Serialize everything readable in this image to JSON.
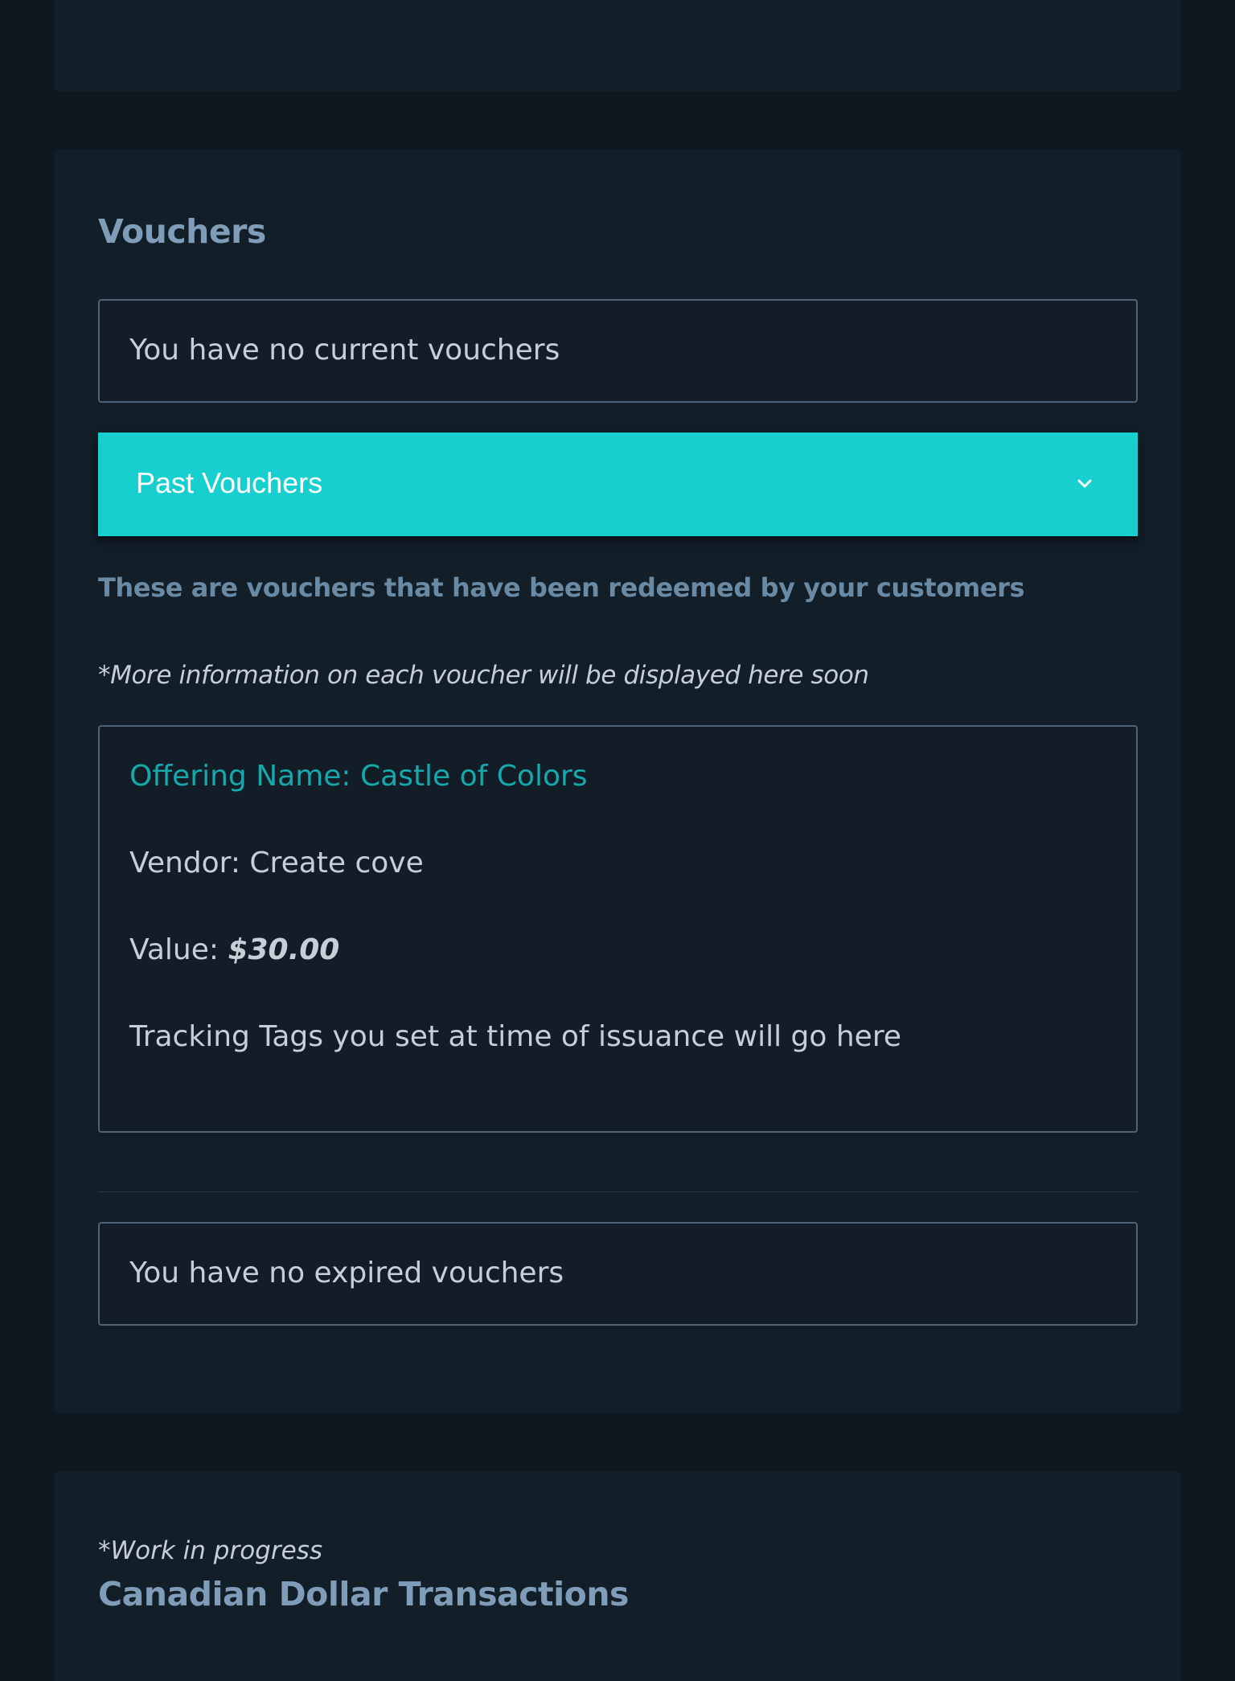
{
  "vouchers": {
    "title": "Vouchers",
    "current_empty": "You have no current vouchers",
    "past_toggle_label": "Past Vouchers",
    "past_description": "These are vouchers that have been redeemed by your customers",
    "past_note": "*More information on each voucher will be displayed here soon",
    "items": [
      {
        "offering_label": "Offering Name: ",
        "offering_name": "Castle of Colors",
        "vendor_label": "Vendor: ",
        "vendor": "Create cove",
        "value_label": "Value: ",
        "value": "$30.00",
        "tracking_tags": "Tracking Tags you set at time of issuance will go here"
      }
    ],
    "expired_empty": "You have no expired vouchers"
  },
  "cad_section": {
    "note": "*Work in progress",
    "title": "Canadian Dollar Transactions"
  },
  "colors": {
    "page_bg": "#0e1820",
    "card_bg": "#121e28",
    "title_color": "#7f9db8",
    "accent": "#18cfcf",
    "offering_color": "#17a8ab",
    "text": "#c6cfd8",
    "border": "#4d6378"
  },
  "icons": {
    "toggle_icon": "chevron-down-icon"
  }
}
